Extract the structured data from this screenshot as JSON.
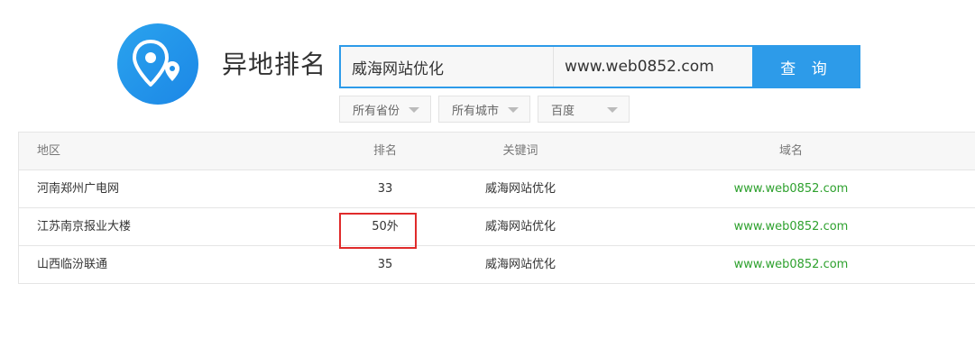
{
  "brand": {
    "title": "异地排名",
    "icon": "map-pin-icon"
  },
  "search": {
    "keyword_value": "威海网站优化",
    "domain_value": "www.web0852.com",
    "button_label": "查 询"
  },
  "filters": [
    {
      "label": "所有省份"
    },
    {
      "label": "所有城市"
    },
    {
      "label": "百度"
    }
  ],
  "table": {
    "headers": {
      "region": "地区",
      "rank": "排名",
      "keyword": "关键词",
      "domain": "域名"
    },
    "rows": [
      {
        "region": "河南郑州广电网",
        "rank": "33",
        "keyword": "威海网站优化",
        "domain": "www.web0852.com"
      },
      {
        "region": "江苏南京报业大楼",
        "rank": "50外",
        "keyword": "威海网站优化",
        "domain": "www.web0852.com"
      },
      {
        "region": "山西临汾联通",
        "rank": "35",
        "keyword": "威海网站优化",
        "domain": "www.web0852.com"
      }
    ]
  },
  "colors": {
    "accent": "#2d9be9",
    "domain_text": "#2ea12e",
    "highlight_border": "#e02b2b"
  }
}
